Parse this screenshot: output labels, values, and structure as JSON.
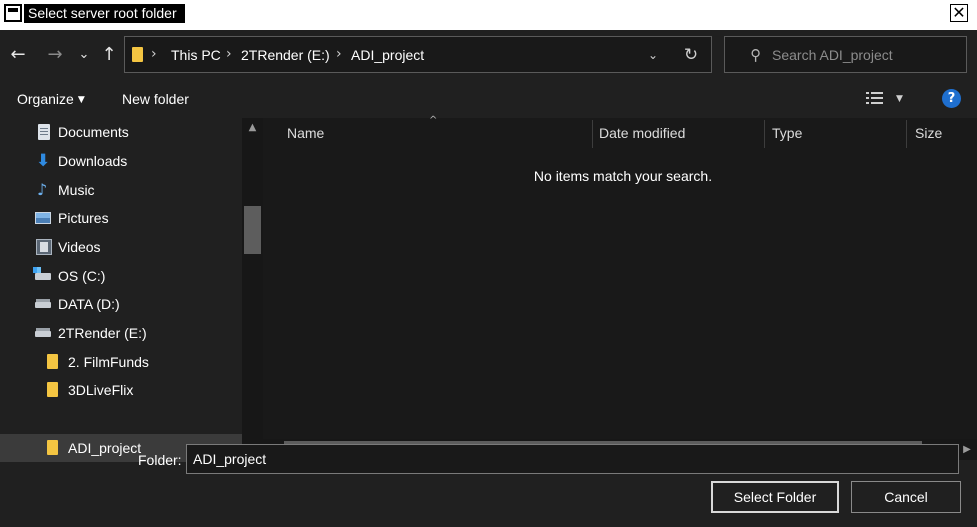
{
  "window": {
    "title": "Select server root folder",
    "close_symbol": "✕"
  },
  "nav": {
    "back_symbol": "←",
    "forward_symbol": "→",
    "recent_symbol": "⌄",
    "up_symbol": "↑"
  },
  "address": {
    "breadcrumbs": [
      "This PC",
      "2TRender (E:)",
      "ADI_project"
    ],
    "separator": "›",
    "dropdown_symbol": "⌄",
    "refresh_symbol": "↻"
  },
  "search": {
    "placeholder": "Search ADI_project",
    "value": "",
    "icon": "search-icon"
  },
  "toolbar": {
    "organize_label": "Organize",
    "caret": "▼",
    "new_folder_label": "New folder",
    "view_caret": "▼",
    "help_symbol": "?"
  },
  "sidebar": {
    "items": [
      {
        "label": "Documents",
        "icon": "documents-icon",
        "selected": false
      },
      {
        "label": "Downloads",
        "icon": "downloads-icon",
        "selected": false
      },
      {
        "label": "Music",
        "icon": "music-icon",
        "selected": false
      },
      {
        "label": "Pictures",
        "icon": "pictures-icon",
        "selected": false
      },
      {
        "label": "Videos",
        "icon": "videos-icon",
        "selected": false
      },
      {
        "label": "OS (C:)",
        "icon": "windows-drive-icon",
        "selected": false
      },
      {
        "label": "DATA (D:)",
        "icon": "drive-icon",
        "selected": false
      },
      {
        "label": "2TRender (E:)",
        "icon": "drive-icon",
        "selected": false
      },
      {
        "label": "2. FilmFunds",
        "icon": "folder-icon",
        "selected": false
      },
      {
        "label": "3DLiveFlix",
        "icon": "folder-icon",
        "selected": false
      },
      {
        "label": "ADI_project",
        "icon": "folder-icon",
        "selected": true
      }
    ],
    "scroll_up": "▲",
    "scroll_down": "▼"
  },
  "filelist": {
    "columns": [
      "Name",
      "Date modified",
      "Type",
      "Size"
    ],
    "sort_caret": "^",
    "empty_message": "No items match your search.",
    "scroll_left": "◀",
    "scroll_right": "▶"
  },
  "footer": {
    "folder_label": "Folder:",
    "folder_value": "ADI_project",
    "select_button": "Select Folder",
    "cancel_button": "Cancel"
  },
  "colors": {
    "background": "#202020",
    "panel": "#191919",
    "selection": "#3b3b3b",
    "folder": "#f4c542",
    "help": "#1f6fcf"
  }
}
